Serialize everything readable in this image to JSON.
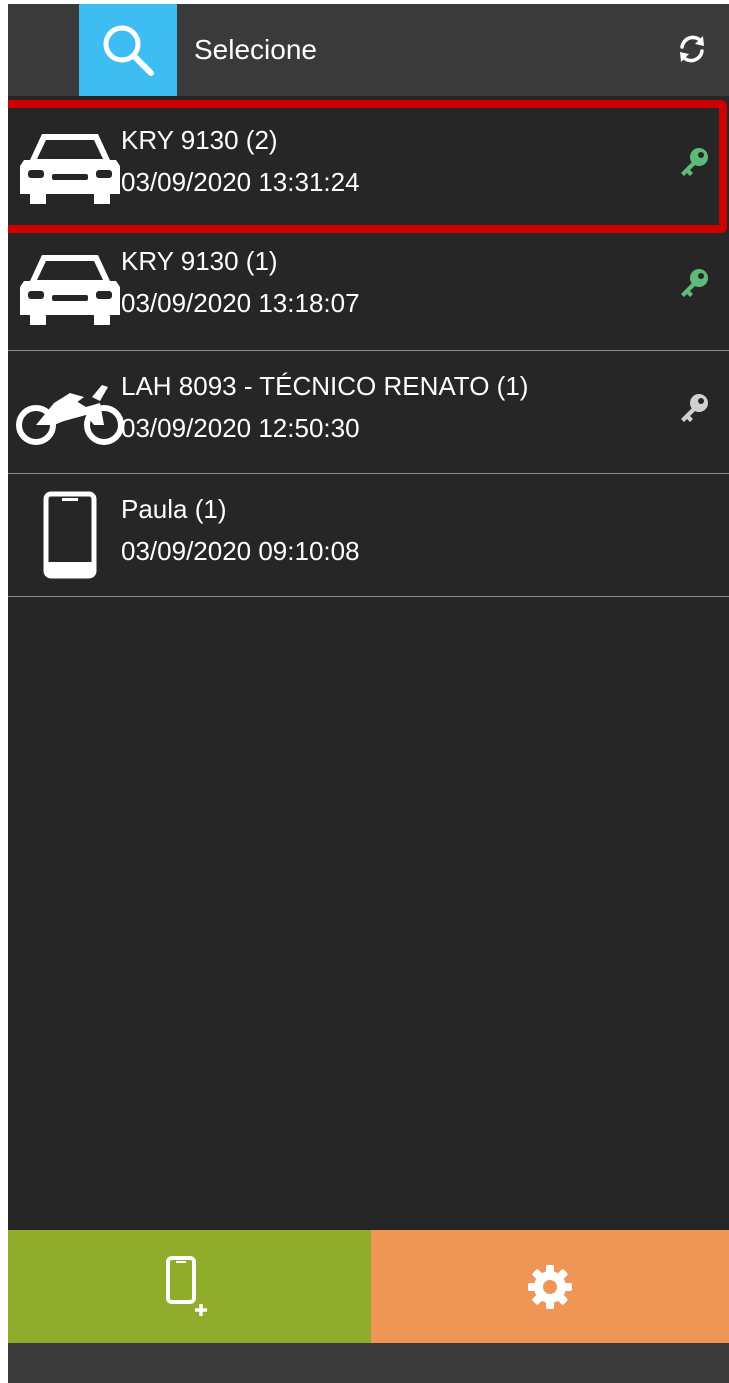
{
  "header": {
    "title": "Selecione",
    "search_icon": "search-icon",
    "refresh_icon": "refresh-icon",
    "accent_color": "#3dbdf2"
  },
  "devices": [
    {
      "type": "car",
      "icon": "car-icon",
      "name": "KRY 9130 (2)",
      "timestamp": "03/09/2020 13:31:24",
      "key_status": "green",
      "selected": true
    },
    {
      "type": "car",
      "icon": "car-icon",
      "name": "KRY 9130 (1)",
      "timestamp": "03/09/2020 13:18:07",
      "key_status": "green",
      "selected": false
    },
    {
      "type": "motorcycle",
      "icon": "motorcycle-icon",
      "name": "LAH 8093 - TÉCNICO RENATO (1)",
      "timestamp": "03/09/2020 12:50:30",
      "key_status": "gray",
      "selected": false
    },
    {
      "type": "phone",
      "icon": "phone-icon",
      "name": "Paula (1)",
      "timestamp": "03/09/2020 09:10:08",
      "key_status": "none",
      "selected": false
    }
  ],
  "colors": {
    "key_on": "#5dbb7a",
    "key_off": "#d0d0d0",
    "selection": "#cc0000",
    "add_button": "#8fad2a",
    "settings_button": "#ef9555"
  },
  "footer": {
    "add_icon": "add-device-icon",
    "settings_icon": "gear-icon"
  }
}
